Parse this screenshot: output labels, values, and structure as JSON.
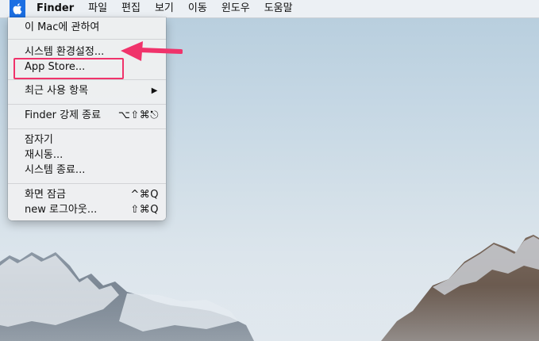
{
  "menubar": {
    "apple_icon": "apple-logo-icon",
    "app_name": "Finder",
    "menus": [
      "파일",
      "편집",
      "보기",
      "이동",
      "윈도우",
      "도움말"
    ]
  },
  "apple_menu": {
    "groups": [
      [
        {
          "label": "이 Mac에 관하여",
          "shortcut": "",
          "submenu": false
        }
      ],
      [
        {
          "label": "시스템 환경설정...",
          "shortcut": "",
          "submenu": false,
          "highlighted": true
        },
        {
          "label": "App Store...",
          "shortcut": "",
          "submenu": false
        }
      ],
      [
        {
          "label": "최근 사용 항목",
          "shortcut": "",
          "submenu": true
        }
      ],
      [
        {
          "label": "Finder 강제 종료",
          "shortcut": "⌥⇧⌘⎋",
          "submenu": false
        }
      ],
      [
        {
          "label": "잠자기",
          "shortcut": "",
          "submenu": false
        },
        {
          "label": "재시동...",
          "shortcut": "",
          "submenu": false
        },
        {
          "label": "시스템 종료...",
          "shortcut": "",
          "submenu": false
        }
      ],
      [
        {
          "label": "화면 잠금",
          "shortcut": "^⌘Q",
          "submenu": false
        },
        {
          "label": "new 로그아웃...",
          "shortcut": "⇧⌘Q",
          "submenu": false
        }
      ]
    ]
  },
  "annotation": {
    "highlight_color": "#f0336b",
    "arrow_icon": "pointer-arrow-icon"
  },
  "colors": {
    "menubar_bg": "#f0f2f5",
    "apple_active_bg": "#1c6fe3"
  }
}
